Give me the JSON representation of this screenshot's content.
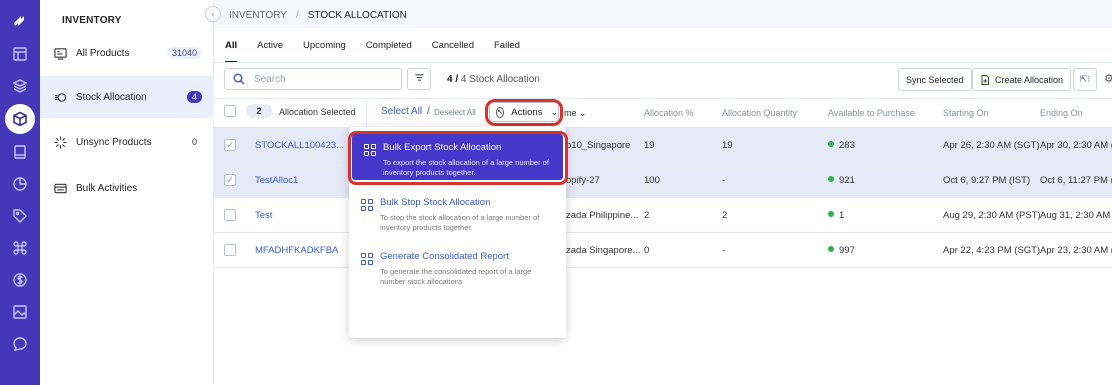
{
  "rail": {
    "icons": [
      "logo-icon",
      "dashboard-icon",
      "layers-icon",
      "inventory-box-icon",
      "book-icon",
      "chart-pie-icon",
      "tag-icon",
      "command-icon",
      "dollar-icon",
      "image-icon",
      "chat-icon"
    ],
    "active": "inventory-box-icon"
  },
  "sidebar": {
    "title": "INVENTORY",
    "items": [
      {
        "label": "All Products",
        "count": "31040"
      },
      {
        "label": "Stock Allocation",
        "count": "4"
      },
      {
        "label": "Unsync Products",
        "count": "0"
      },
      {
        "label": "Bulk Activities",
        "count": ""
      }
    ]
  },
  "breadcrumb": {
    "root": "INVENTORY",
    "separator": "/",
    "current": "STOCK ALLOCATION"
  },
  "tabs": [
    "All",
    "Active",
    "Upcoming",
    "Completed",
    "Cancelled",
    "Failed"
  ],
  "toolbar": {
    "search_placeholder": "Search",
    "count_bold": "4 / ",
    "count_text": "4 Stock Allocation",
    "sync_label": "Sync Selected",
    "create_label": "Create Allocation"
  },
  "selection": {
    "count": "2",
    "label": "Allocation Selected",
    "select_all": "Select All",
    "slash": "/",
    "deselect_all": "Deselect All",
    "actions_label": "Actions"
  },
  "columns": {
    "name_partial": "me",
    "allocation_pct": "Allocation %",
    "allocation_qty": "Allocation Quantity",
    "available": "Available to Purchase",
    "starting": "Starting On",
    "ending": "Ending On"
  },
  "rows": [
    {
      "name": "STOCKALL100423...",
      "store": "o10_Singapore",
      "pct": "19",
      "qty": "19",
      "available": "283",
      "start": "Apr 26, 2:30 AM (SGT)",
      "end": "Apr 30, 2:30 AM (S"
    },
    {
      "name": "TestAlloc1",
      "store": "opify-27",
      "pct": "100",
      "qty": "-",
      "available": "921",
      "start": "Oct 6, 9:27 PM (IST)",
      "end": "Oct 6, 11:27 PM (IS"
    },
    {
      "name": "Test",
      "store": "zada Philippine...",
      "pct": "2",
      "qty": "2",
      "available": "1",
      "start": "Aug 29, 2:30 AM (PST)",
      "end": "Aug 31, 2:30 AM (P"
    },
    {
      "name": "MFADHFKADKFBA",
      "store": "zada Singapore...",
      "pct": "0",
      "qty": "-",
      "available": "997",
      "start": "Apr 22, 4:23 PM (SGT)",
      "end": "Apr 23, 2:30 AM (S"
    }
  ],
  "menu": [
    {
      "title": "Bulk Export Stock Allocation",
      "desc": "To export the stock allocation of a large number of inventory products together."
    },
    {
      "title": "Bulk Stop Stock Allocation",
      "desc": "To stop the stock allocation of a large number of inventory products together."
    },
    {
      "title": "Generate Consolidated Report",
      "desc": "To generate the consolidated report of a large number stock allocations"
    }
  ],
  "colors": {
    "brand": "#4437b8",
    "link": "#3d5bc4",
    "highlight_ring": "#d8322c",
    "available_dot": "#2bb24c"
  }
}
